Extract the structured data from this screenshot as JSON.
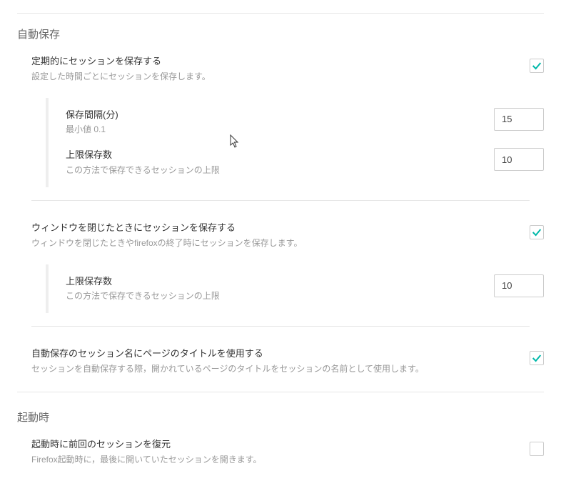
{
  "autosave": {
    "heading": "自動保存",
    "periodic": {
      "title": "定期的にセッションを保存する",
      "desc": "設定した時間ごとにセッションを保存します。",
      "checked": true,
      "interval": {
        "title": "保存間隔(分)",
        "desc": "最小値 0.1",
        "value": "15"
      },
      "limit": {
        "title": "上限保存数",
        "desc": "この方法で保存できるセッションの上限",
        "value": "10"
      }
    },
    "onclose": {
      "title": "ウィンドウを閉じたときにセッションを保存する",
      "desc": "ウィンドウを閉じたときやfirefoxの終了時にセッションを保存します。",
      "checked": true,
      "limit": {
        "title": "上限保存数",
        "desc": "この方法で保存できるセッションの上限",
        "value": "10"
      }
    },
    "usetitle": {
      "title": "自動保存のセッション名にページのタイトルを使用する",
      "desc": "セッションを自動保存する際，開かれているページのタイトルをセッションの名前として使用します。",
      "checked": true
    }
  },
  "startup": {
    "heading": "起動時",
    "restore": {
      "title": "起動時に前回のセッションを復元",
      "desc": "Firefox起動時に，最後に開いていたセッションを開きます。",
      "checked": false
    }
  }
}
